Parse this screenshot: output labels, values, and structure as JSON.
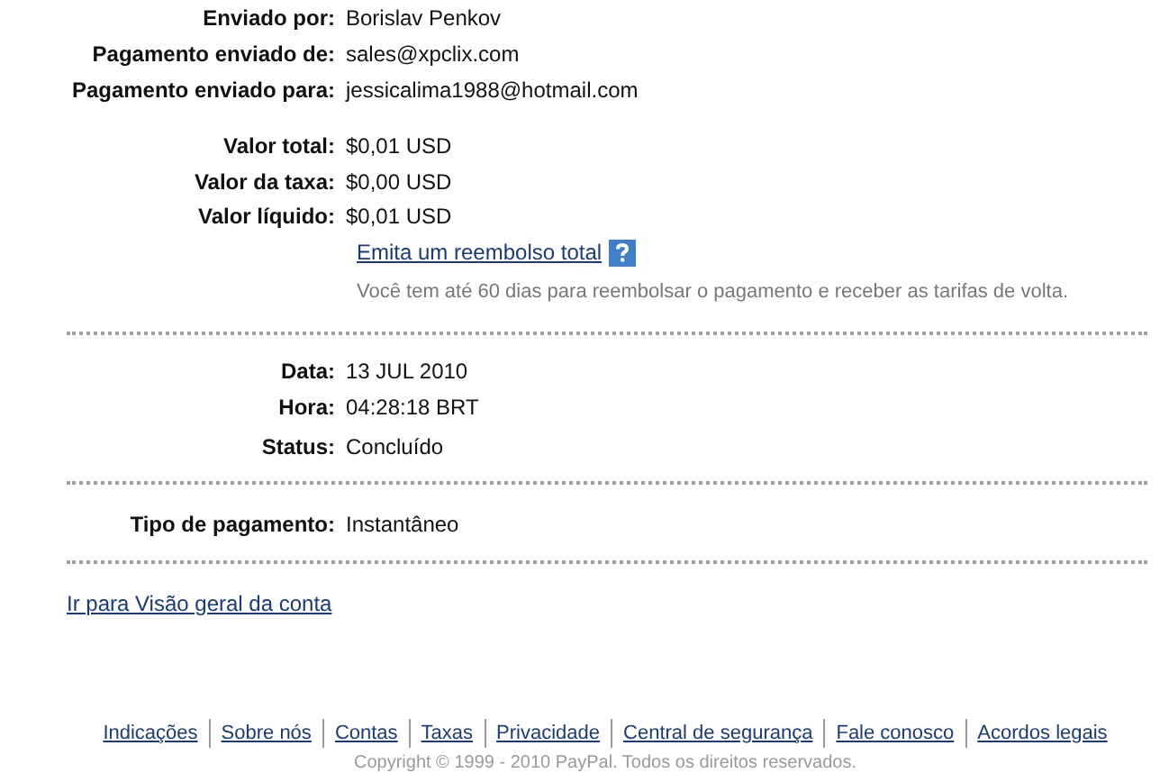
{
  "sender_info": [
    {
      "label": "Enviado por:",
      "value": "Borislav Penkov"
    },
    {
      "label": "Pagamento enviado de:",
      "value": "sales@xpclix.com"
    },
    {
      "label": "Pagamento enviado para:",
      "value": "jessicalima1988@hotmail.com"
    }
  ],
  "amounts": [
    {
      "label": "Valor total:",
      "value": "$0,01 USD"
    },
    {
      "label": "Valor da taxa:",
      "value": "$0,00 USD"
    },
    {
      "label": "Valor líquido:",
      "value": "$0,01 USD"
    }
  ],
  "refund_link": "Emita um reembolso total",
  "refund_note": "Você tem até 60 dias para reembolsar o pagamento e receber as tarifas de volta.",
  "transaction": [
    {
      "label": "Data:",
      "value": "13 JUL 2010"
    },
    {
      "label": "Hora:",
      "value": "04:28:18 BRT"
    },
    {
      "label": "Status:",
      "value": "Concluído"
    }
  ],
  "payment": [
    {
      "label": "Tipo de pagamento:",
      "value": "Instantâneo"
    }
  ],
  "account_link": "Ir para Visão geral da conta",
  "footer_links": [
    "Indicações",
    "Sobre nós",
    "Contas",
    "Taxas",
    "Privacidade",
    "Central de segurança",
    "Fale conosco",
    "Acordos legais"
  ],
  "copyright": "Copyright © 1999 - 2010 PayPal. Todos os direitos reservados."
}
